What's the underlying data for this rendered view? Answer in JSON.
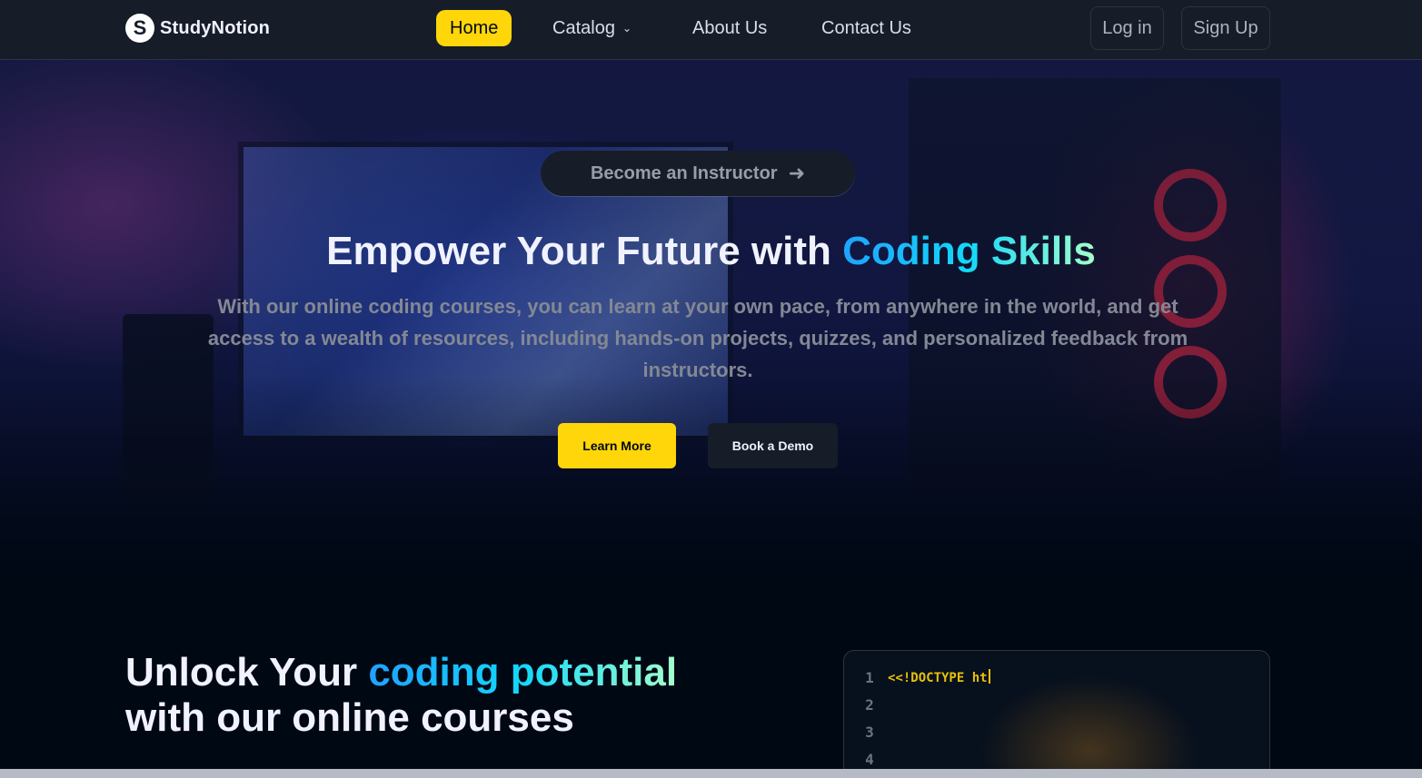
{
  "brand": {
    "logo_letter": "S",
    "name": "StudyNotion"
  },
  "nav": {
    "links": [
      {
        "label": "Home",
        "active": true
      },
      {
        "label": "Catalog",
        "active": false
      },
      {
        "label": "About Us",
        "active": false
      },
      {
        "label": "Contact Us",
        "active": false
      }
    ],
    "login_label": "Log in",
    "signup_label": "Sign Up"
  },
  "hero": {
    "pill_label": "Become an Instructor",
    "title_prefix": "Empower Your Future with ",
    "title_highlight": "Coding Skills",
    "subtitle": "With our online coding courses, you can learn at your own pace, from anywhere in the world, and get access to a wealth of resources, including hands-on projects, quizzes, and personalized feedback from instructors.",
    "primary_cta": "Learn More",
    "secondary_cta": "Book a Demo"
  },
  "section2": {
    "title_prefix": "Unlock Your ",
    "title_highlight": "coding potential",
    "title_line2": "with our online courses"
  },
  "code_block": {
    "line_numbers": [
      "1",
      "2",
      "3",
      "4"
    ],
    "typed_text": "<<!DOCTYPE ht"
  },
  "colors": {
    "accent_yellow": "#FFD60A",
    "nav_bg": "#161D29",
    "page_bg": "#000814",
    "gradient_start": "#1FA2FF",
    "gradient_end": "#A6FFCB"
  }
}
